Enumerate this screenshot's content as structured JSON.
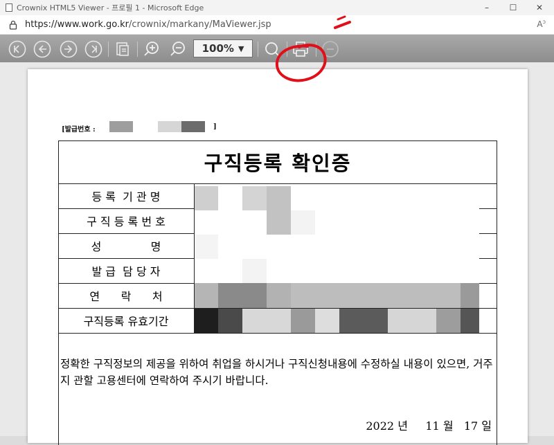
{
  "browser": {
    "title": "Crownix HTML5 Viewer - 프로필 1 - Microsoft Edge",
    "url_host": "https://www.work.go.kr",
    "url_path": "/crownix/markany/MaViewer.jsp",
    "window_controls": {
      "minimize": "–",
      "maximize": "☐",
      "close": "✕"
    }
  },
  "toolbar": {
    "zoom_value": "100%",
    "zoom_caret": "▼",
    "buttons": [
      "first-page-icon",
      "prev-page-icon",
      "next-page-icon",
      "last-page-icon",
      "save-icon",
      "zoom-in-icon",
      "zoom-out-icon",
      "search-icon",
      "print-icon",
      "close-icon"
    ]
  },
  "document": {
    "issue_number_label": "[발급번호 :",
    "issue_number_end": "]",
    "title": "구직등록 확인증",
    "rows": [
      {
        "label": "등 록  기 관 명"
      },
      {
        "label": "구 직 등 록 번 호"
      },
      {
        "label": "성              명"
      },
      {
        "label": "발 급  담 당 자"
      },
      {
        "label": "연      락      처"
      },
      {
        "label": "구직등록 유효기간"
      }
    ],
    "body": "정확한 구직정보의 제공을 위하여 취업을 하시거나 구직신청내용에 수정하실 내용이 있으면, 거주지 관할 고용센터에 연락하여 주시기 바랍니다.",
    "date": {
      "year": "2022",
      "year_unit": "년",
      "month": "11",
      "month_unit": "월",
      "day": "17",
      "day_unit": "일"
    }
  },
  "colors": {
    "toolbar": "#9b9b9b",
    "annotation": "#e0101a"
  }
}
